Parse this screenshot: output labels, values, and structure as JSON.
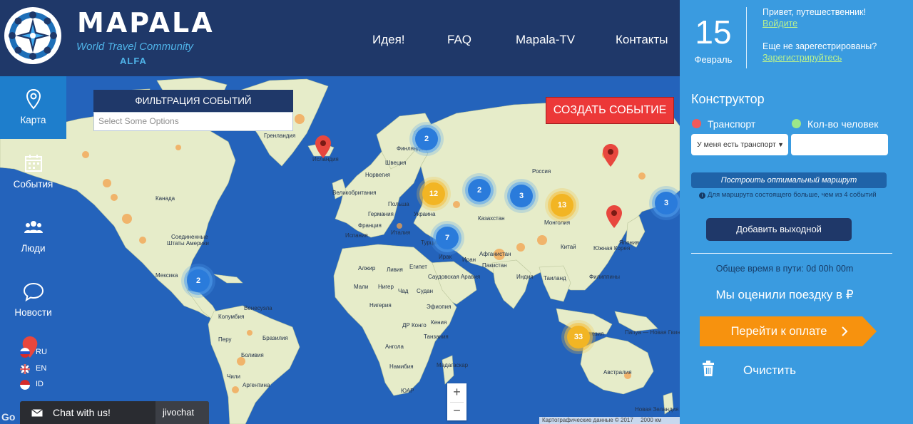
{
  "header": {
    "brand": "MAPALA",
    "tagline": "World Travel Community",
    "edition": "ALFA",
    "nav": [
      "Идея!",
      "FAQ",
      "Mapala-TV",
      "Контакты"
    ]
  },
  "date": {
    "day": "15",
    "month": "Февраль"
  },
  "user": {
    "greeting": "Привет, путешественник!",
    "login_link": "Войдите",
    "not_registered": "Еще не зарегестрированы?",
    "register_link": "Зарегистрируйтесь"
  },
  "sidenav": [
    {
      "label": "Карта",
      "icon": "map-pin-icon",
      "active": true
    },
    {
      "label": "События",
      "icon": "calendar-icon",
      "active": false
    },
    {
      "label": "Люди",
      "icon": "people-icon",
      "active": false
    },
    {
      "label": "Новости",
      "icon": "chat-bubble-icon",
      "active": false
    }
  ],
  "languages": [
    "RU",
    "EN",
    "ID"
  ],
  "filter": {
    "title": "ФИЛЬТРАЦИЯ СОБЫТИЙ",
    "placeholder": "Select Some Options"
  },
  "create_event": "СОЗДАТЬ СОБЫТИЕ",
  "map": {
    "clusters": [
      {
        "count": "2",
        "color": "blue"
      },
      {
        "count": "12",
        "color": "yellow"
      },
      {
        "count": "2",
        "color": "blue"
      },
      {
        "count": "3",
        "color": "blue"
      },
      {
        "count": "13",
        "color": "yellow"
      },
      {
        "count": "7",
        "color": "blue"
      },
      {
        "count": "3",
        "color": "blue"
      },
      {
        "count": "2",
        "color": "blue"
      },
      {
        "count": "33",
        "color": "yellow"
      }
    ],
    "pins": 3,
    "labels": {
      "greenland": "Гренландия",
      "iceland": "Исландия",
      "finland": "Финляндия",
      "norway": "Норвегия",
      "sweden": "Швеция",
      "russia": "Россия",
      "uk": "Великобритания",
      "poland": "Польша",
      "germany": "Германия",
      "ukraine": "Украина",
      "france": "Франция",
      "spain": "Испания",
      "italy": "Италия",
      "kazakhstan": "Казахстан",
      "mongolia": "Монголия",
      "turkey": "Турция",
      "iraq": "Ирак",
      "iran": "Иран",
      "afghanistan": "Афганистан",
      "pakistan": "Пакистан",
      "china": "Китай",
      "india": "Индия",
      "japan": "Япония",
      "south_korea": "Южная Корея",
      "canada": "Канада",
      "usa_1": "Соединенные",
      "usa_2": "Штаты Америки",
      "mexico": "Мексика",
      "venezuela": "Венесуэла",
      "colombia": "Колумбия",
      "peru": "Перу",
      "brazil": "Бразилия",
      "bolivia": "Боливия",
      "chile": "Чили",
      "argentina": "Аргентина",
      "algeria": "Алжир",
      "libya": "Ливия",
      "egypt": "Египет",
      "mali": "Мали",
      "niger": "Нигер",
      "chad": "Чад",
      "sudan": "Судан",
      "nigeria": "Нигерия",
      "ethiopia": "Эфиопия",
      "dr_congo": "ДР Конго",
      "kenya": "Кения",
      "tanzania": "Танзания",
      "angola": "Ангола",
      "namibia": "Намибия",
      "south_africa": "ЮАР",
      "madagascar": "Мадагаскар",
      "saudi": "Саудовская Аравия",
      "thailand": "Таиланд",
      "philippines": "Филиппины",
      "indonesia": "Индонезия",
      "papua": "Папуа — Новая Гвинея",
      "australia": "Австралия",
      "new_zealand": "Новая Зеландия"
    },
    "zoom_in": "+",
    "zoom_out": "−",
    "attribution": "Картографические данные © 2017",
    "scale": "2000 км",
    "provider_mark": "Go"
  },
  "chat": {
    "label": "Chat with us!",
    "provider": "jivochat"
  },
  "constructor": {
    "title": "Конструктор",
    "transport_legend": "Транспорт",
    "people_legend": "Кол-во человек",
    "transport_select": "У меня есть транспорт",
    "route_button": "Построить оптимальный маршрут",
    "route_note": "Для маршрута состоящего больше, чем из 4 событий",
    "add_day_button": "Добавить выходной",
    "total_time": "Общее время в пути: 0d 00h 00m",
    "estimate": "Мы оценили поездку в ₽",
    "pay_button": "Перейти к оплате",
    "clear": "Очистить"
  },
  "colors": {
    "header": "#1f3869",
    "panel": "#3a9be0",
    "ocean": "#2463bb",
    "land": "#e6ecc9",
    "create_button": "#ec3838",
    "pay_button": "#f7920e",
    "transport_dot": "#f05a5a",
    "people_dot": "#9be88a",
    "link": "#b7f08f"
  }
}
